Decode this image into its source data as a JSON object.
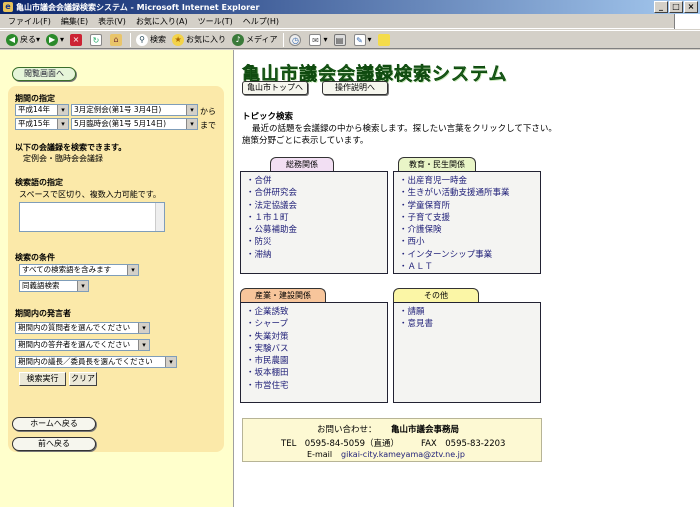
{
  "window": {
    "title": "亀山市議会会議録検索システム - Microsoft Internet Explorer"
  },
  "menu": [
    "ファイル(F)",
    "編集(E)",
    "表示(V)",
    "お気に入り(A)",
    "ツール(T)",
    "ヘルプ(H)"
  ],
  "toolbar": {
    "back": "戻る",
    "search": "検索",
    "favorites": "お気に入り",
    "media": "メディア"
  },
  "left": {
    "top_button": "閲覧画面へ",
    "period_heading": "期間の指定",
    "from_year": "平成14年",
    "from_session": "3月定例会(第1号 3月4日)",
    "from_suffix": "から",
    "to_year": "平成15年",
    "to_session": "5月臨時会(第1号 5月14日)",
    "to_suffix": "まで",
    "searchable_heading": "以下の会議録を検索できます。",
    "searchable_desc": "定例会・臨時会会議録",
    "keyword_heading": "検索語の指定",
    "keyword_desc": "スペースで区切り、複数入力可能です。",
    "condition_heading": "検索の条件",
    "condition_select": "すべての検索語を含みます",
    "synonym_select": "同義語検索",
    "speaker_heading": "期間内の発言者",
    "speaker_questioner": "期間内の質問者を選んでください",
    "speaker_answerer": "期間内の答弁者を選んでください",
    "speaker_chair": "期間内の議長／委員長を選んでください",
    "search_button": "検索実行",
    "clear_button": "クリア",
    "home_button": "ホームへ戻る",
    "back_button": "前へ戻る"
  },
  "main": {
    "title": "亀山市議会会議録検索システム",
    "nav_top": "亀山市トップへ",
    "nav_help": "操作説明へ",
    "topic_heading": "トピック検索",
    "topic_line1": "最近の話題を会議録の中から検索します。探したい言葉をクリックして下さい。",
    "topic_line2": "施策分野ごとに表示しています。",
    "categories": [
      {
        "name": "総務関係",
        "color": "#f2dff3",
        "items": [
          "合併",
          "合併研究会",
          "法定協議会",
          "１市１町",
          "公募補助金",
          "防災",
          "滞納"
        ]
      },
      {
        "name": "教育・民生関係",
        "color": "#e9f5c7",
        "items": [
          "出産育児一時金",
          "生きがい活動支援通所事業",
          "学童保育所",
          "子育て支援",
          "介護保険",
          "西小",
          "インターンシップ事業",
          "ＡＬＴ"
        ]
      },
      {
        "name": "産業・建設関係",
        "color": "#f7c59b",
        "items": [
          "企業誘致",
          "シャープ",
          "失業対策",
          "実験バス",
          "市民農園",
          "坂本棚田",
          "市営住宅"
        ]
      },
      {
        "name": "その他",
        "color": "#fbf6a6",
        "items": [
          "請願",
          "意見書"
        ]
      }
    ],
    "contact": {
      "label": "お問い合わせ：",
      "org": "亀山市議会事務局",
      "tel": "TEL　0595-84-5059（直通）",
      "fax": "FAX　0595-83-2203",
      "email_label": "E-mail",
      "email": "gikai-city.kameyama@ztv.ne.jp"
    }
  }
}
